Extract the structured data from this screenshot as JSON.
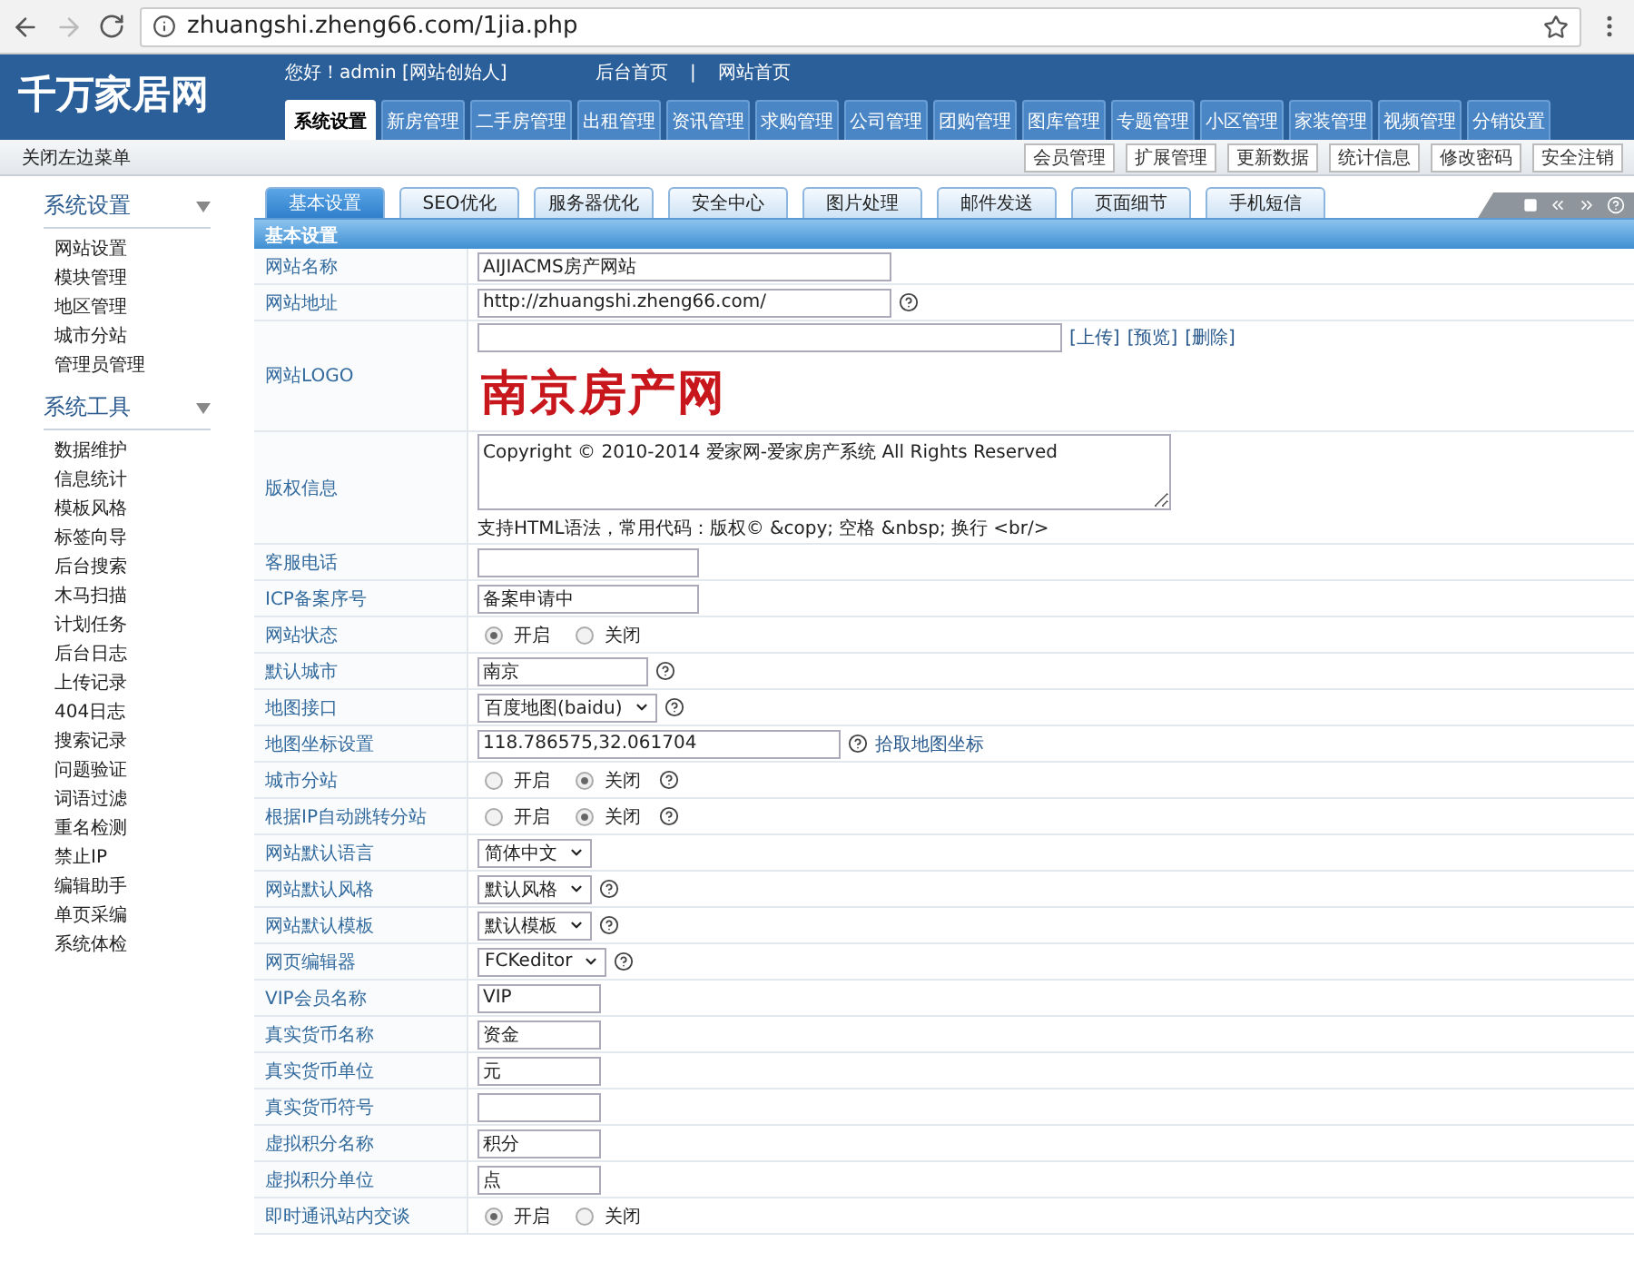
{
  "browser": {
    "url": "zhuangshi.zheng66.com/1jia.php"
  },
  "header": {
    "logo": "千万家居网",
    "greeting": "您好！admin [网站创始人]",
    "links": [
      "后台首页",
      "网站首页"
    ],
    "separator": "|",
    "nav": [
      {
        "label": "系统设置",
        "selected": true
      },
      {
        "label": "新房管理",
        "selected": false
      },
      {
        "label": "二手房管理",
        "selected": false
      },
      {
        "label": "出租管理",
        "selected": false
      },
      {
        "label": "资讯管理",
        "selected": false
      },
      {
        "label": "求购管理",
        "selected": false
      },
      {
        "label": "公司管理",
        "selected": false
      },
      {
        "label": "团购管理",
        "selected": false
      },
      {
        "label": "图库管理",
        "selected": false
      },
      {
        "label": "专题管理",
        "selected": false
      },
      {
        "label": "小区管理",
        "selected": false
      },
      {
        "label": "家装管理",
        "selected": false
      },
      {
        "label": "视频管理",
        "selected": false
      },
      {
        "label": "分销设置",
        "selected": false
      }
    ]
  },
  "subbar": {
    "toggle": "关闭左边菜单",
    "buttons": [
      "会员管理",
      "扩展管理",
      "更新数据",
      "统计信息",
      "修改密码",
      "安全注销"
    ]
  },
  "sidebar": {
    "sections": [
      {
        "title": "系统设置",
        "expanded": true,
        "items": [
          "网站设置",
          "模块管理",
          "地区管理",
          "城市分站",
          "管理员管理"
        ]
      },
      {
        "title": "系统工具",
        "expanded": true,
        "items": [
          "数据维护",
          "信息统计",
          "模板风格",
          "标签向导",
          "后台搜索",
          "木马扫描",
          "计划任务",
          "后台日志",
          "上传记录",
          "404日志",
          "搜索记录",
          "问题验证",
          "词语过滤",
          "重名检测",
          "禁止IP",
          "编辑助手",
          "单页采编",
          "系统体检"
        ]
      }
    ]
  },
  "tabs": [
    {
      "label": "基本设置",
      "selected": true
    },
    {
      "label": "SEO优化",
      "selected": false
    },
    {
      "label": "服务器优化",
      "selected": false
    },
    {
      "label": "安全中心",
      "selected": false
    },
    {
      "label": "图片处理",
      "selected": false
    },
    {
      "label": "邮件发送",
      "selected": false
    },
    {
      "label": "页面细节",
      "selected": false
    },
    {
      "label": "手机短信",
      "selected": false
    }
  ],
  "panel_title": "基本设置",
  "rows": [
    {
      "label": "网站名称",
      "kind": "text",
      "value": "AIJIACMS房产网站",
      "help": false
    },
    {
      "label": "网站地址",
      "kind": "text",
      "value": "http://zhuangshi.zheng66.com/",
      "help": true
    },
    {
      "label": "网站LOGO",
      "kind": "logo",
      "value": "",
      "links": [
        "[上传]",
        "[预览]",
        "[删除]"
      ],
      "logo_text": "南京房产网"
    },
    {
      "label": "版权信息",
      "kind": "textarea",
      "value": "Copyright © 2010-2014 爱家网-爱家房产系统 All Rights Reserved",
      "hint": "支持HTML语法，常用代码：版权© &copy; 空格 &nbsp; 换行 <br/>"
    },
    {
      "label": "客服电话",
      "kind": "text_medium",
      "value": "",
      "help": false
    },
    {
      "label": "ICP备案序号",
      "kind": "text_medium",
      "value": "备案申请中",
      "help": false
    },
    {
      "label": "网站状态",
      "kind": "radio",
      "options": [
        {
          "label": "开启",
          "selected": true
        },
        {
          "label": "关闭",
          "selected": false
        }
      ],
      "help": false
    },
    {
      "label": "默认城市",
      "kind": "text_short",
      "value": "南京",
      "help": true
    },
    {
      "label": "地图接口",
      "kind": "select",
      "value": "百度地图(baidu)",
      "help": true
    },
    {
      "label": "地图坐标设置",
      "kind": "coords",
      "value": "118.786575,32.061704",
      "help": true,
      "link": "拾取地图坐标"
    },
    {
      "label": "城市分站",
      "kind": "radio",
      "options": [
        {
          "label": "开启",
          "selected": false
        },
        {
          "label": "关闭",
          "selected": true
        }
      ],
      "help": true
    },
    {
      "label": "根据IP自动跳转分站",
      "kind": "radio",
      "options": [
        {
          "label": "开启",
          "selected": false
        },
        {
          "label": "关闭",
          "selected": true
        }
      ],
      "help": true
    },
    {
      "label": "网站默认语言",
      "kind": "select",
      "value": "简体中文",
      "help": false
    },
    {
      "label": "网站默认风格",
      "kind": "select",
      "value": "默认风格",
      "help": true
    },
    {
      "label": "网站默认模板",
      "kind": "select",
      "value": "默认模板",
      "help": true
    },
    {
      "label": "网页编辑器",
      "kind": "select",
      "value": "FCKeditor",
      "help": true
    },
    {
      "label": "VIP会员名称",
      "kind": "text_tiny",
      "value": "VIP",
      "help": false
    },
    {
      "label": "真实货币名称",
      "kind": "text_tiny",
      "value": "资金",
      "help": false
    },
    {
      "label": "真实货币单位",
      "kind": "text_tiny",
      "value": "元",
      "help": false
    },
    {
      "label": "真实货币符号",
      "kind": "text_tiny",
      "value": "",
      "help": false
    },
    {
      "label": "虚拟积分名称",
      "kind": "text_tiny",
      "value": "积分",
      "help": false
    },
    {
      "label": "虚拟积分单位",
      "kind": "text_tiny",
      "value": "点",
      "help": false
    },
    {
      "label": "即时通讯站内交谈",
      "kind": "radio",
      "options": [
        {
          "label": "开启",
          "selected": true
        },
        {
          "label": "关闭",
          "selected": false
        }
      ],
      "help": false
    }
  ]
}
